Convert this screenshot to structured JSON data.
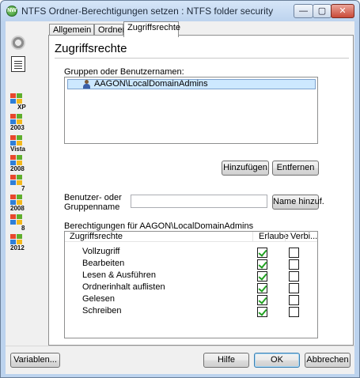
{
  "window": {
    "title": "NTFS Ordner-Berechtigungen setzen : NTFS folder security",
    "app_icon_text": "NW",
    "controls": {
      "minimize": "—",
      "maximize": "▢",
      "close": "✕"
    }
  },
  "left_strip": {
    "icons": [
      "gear-icon",
      "document-icon"
    ],
    "os_items": [
      {
        "label": "XP"
      },
      {
        "label": "2003"
      },
      {
        "label": "Vista"
      },
      {
        "label": "2008"
      },
      {
        "label": "7"
      },
      {
        "label": "2008"
      },
      {
        "label": "8"
      },
      {
        "label": "2012"
      }
    ]
  },
  "tabs": [
    "Allgemein",
    "Ordner",
    "Zugriffsrechte"
  ],
  "active_tab": "Zugriffsrechte",
  "panel": {
    "title": "Zugriffsrechte",
    "groups_label": "Gruppen oder Benutzernamen:",
    "groups": [
      "AAGON\\LocalDomainAdmins"
    ],
    "add_button": "Hinzufügen",
    "remove_button": "Entfernen",
    "user_label_line1": "Benutzer- oder",
    "user_label_line2": "Gruppenname",
    "user_input_value": "",
    "name_add_button": "Name hinzuf.",
    "permissions_for_label": "Berechtigungen für AAGON\\LocalDomainAdmins",
    "columns": {
      "name": "Zugriffsrechte",
      "allow": "Erlaube",
      "deny": "Verbi..."
    },
    "permissions": [
      {
        "name": "Vollzugriff",
        "allow": true,
        "deny": false
      },
      {
        "name": "Bearbeiten",
        "allow": true,
        "deny": false
      },
      {
        "name": "Lesen & Ausführen",
        "allow": true,
        "deny": false
      },
      {
        "name": "Ordnerinhalt auflisten",
        "allow": true,
        "deny": false
      },
      {
        "name": "Gelesen",
        "allow": true,
        "deny": false
      },
      {
        "name": "Schreiben",
        "allow": true,
        "deny": false
      }
    ]
  },
  "footer": {
    "variables_button": "Variablen...",
    "help_button": "Hilfe",
    "ok_button": "OK",
    "cancel_button": "Abbrechen"
  }
}
